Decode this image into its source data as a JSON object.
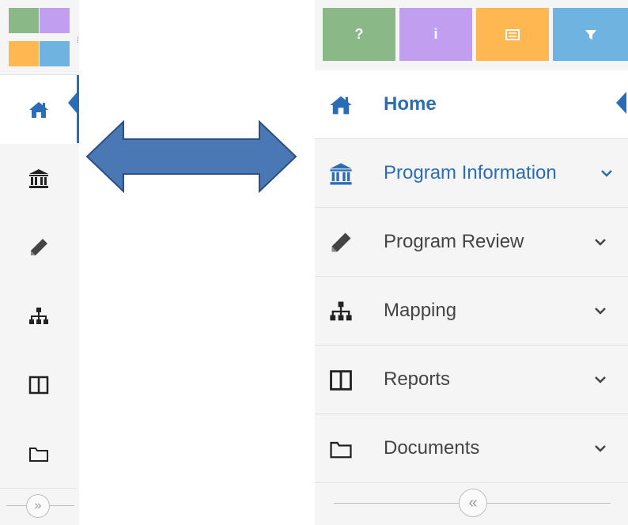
{
  "colors": {
    "accent": "#2a6db4",
    "green": "#8ab887",
    "purple": "#c29ef0",
    "orange": "#ffb752",
    "blue": "#6fb3e0",
    "arrow": "#4a78b5"
  },
  "toolbar": [
    {
      "glyph": "?",
      "icon": "help-icon",
      "color": "#8ab887"
    },
    {
      "glyph": "i",
      "icon": "info-icon",
      "color": "#c29ef0"
    },
    {
      "glyph": "",
      "icon": "list-icon",
      "color": "#ffb752"
    },
    {
      "glyph": "",
      "icon": "filter-icon",
      "color": "#6fb3e0"
    }
  ],
  "nav": {
    "items": [
      {
        "label": "Home",
        "icon": "home-icon",
        "active": true
      },
      {
        "label": "Program Information",
        "icon": "bank-icon",
        "active": false
      },
      {
        "label": "Program Review",
        "icon": "pencil-icon",
        "active": false
      },
      {
        "label": "Mapping",
        "icon": "sitemap-icon",
        "active": false
      },
      {
        "label": "Reports",
        "icon": "columns-icon",
        "active": false
      },
      {
        "label": "Documents",
        "icon": "folder-icon",
        "active": false
      }
    ]
  },
  "collapsed_toggle": "»",
  "expanded_toggle": "«"
}
